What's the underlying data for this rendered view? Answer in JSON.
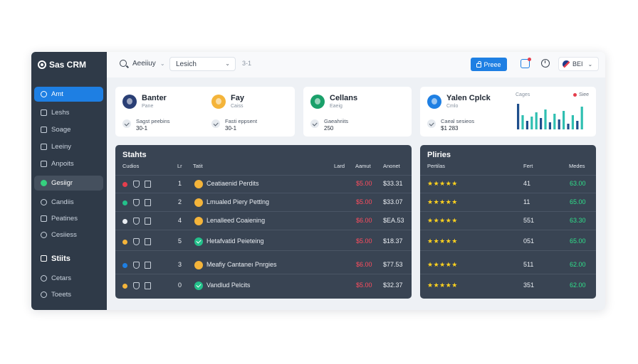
{
  "app": {
    "title": "Sas CRM"
  },
  "sidebar": {
    "items": [
      {
        "label": "Amt",
        "icon": "home-icon",
        "state": "active"
      },
      {
        "label": "Leshs",
        "icon": "pencil-icon",
        "state": ""
      },
      {
        "label": "Soage",
        "icon": "folder-icon",
        "state": ""
      },
      {
        "label": "Leeiny",
        "icon": "list-icon",
        "state": ""
      },
      {
        "label": "Anpoits",
        "icon": "calendar-icon",
        "state": ""
      },
      {
        "label": "Gesiigr",
        "icon": "gear-icon",
        "state": "hover"
      },
      {
        "label": "Candiis",
        "icon": "chat-icon",
        "state": ""
      },
      {
        "label": "Peatines",
        "icon": "box-icon",
        "state": ""
      },
      {
        "label": "Cesiiess",
        "icon": "users-icon",
        "state": ""
      },
      {
        "label": "Stiits",
        "icon": "chart-icon",
        "state": "heading"
      },
      {
        "label": "Cetars",
        "icon": "settings-icon",
        "state": ""
      },
      {
        "label": "Toeets",
        "icon": "ticket-icon",
        "state": ""
      }
    ]
  },
  "topbar": {
    "filter_label": "Aeeiiuy",
    "select_value": "Lesich",
    "meta": "3-1",
    "primary_button": "Preee",
    "user": "BEI"
  },
  "cards": [
    {
      "contacts": [
        {
          "name": "Banter",
          "sub": "Pane",
          "metric_label": "Sagst peebins",
          "metric_value": "30-1",
          "avatar_color": "#2a3f75"
        },
        {
          "name": "Fay",
          "sub": "Caiss",
          "metric_label": "Fasti eppsent",
          "metric_value": "30-1",
          "avatar_color": "#f4b43a"
        }
      ]
    },
    {
      "contacts": [
        {
          "name": "Cellans",
          "sub": "Eaeig",
          "metric_label": "Gaeahriits",
          "metric_value": "250",
          "avatar_color": "#1aa06a"
        }
      ]
    },
    {
      "contacts": [
        {
          "name": "Yalen Cplck",
          "sub": "Cmlo",
          "metric_label": "Caeal sesieos",
          "metric_value": "$1 283",
          "avatar_color": "#1e7fe3"
        }
      ],
      "spark_title": "Cages",
      "spark_legend": "Siee"
    }
  ],
  "stats_panel": {
    "title": "Stahts",
    "headers": {
      "status": "Cudios",
      "num": "Lr",
      "name": "Tatit",
      "lead": "Lard",
      "amount": "Aamut",
      "total": "Anonet"
    },
    "rows": [
      {
        "dot_color": "#e53e4d",
        "num": "1",
        "product": "Ceatiaenid Perdits",
        "icon_variant": "",
        "lead": "$5.00",
        "total": "$33.31"
      },
      {
        "dot_color": "#23c08a",
        "num": "2",
        "product": "Lmualed Piery Pettlng",
        "icon_variant": "",
        "lead": "$5.00",
        "total": "$33.07"
      },
      {
        "dot_color": "#e9edf2",
        "num": "4",
        "product": "Lenalleed Coaiening",
        "icon_variant": "",
        "lead": "$6.00",
        "total": "$EA.53"
      },
      {
        "dot_color": "#f4b43a",
        "num": "5",
        "product": "Hetafvatid Peieteing",
        "icon_variant": "teal",
        "lead": "$5.00",
        "total": "$18.37"
      },
      {
        "dot_color": "#1e7fe3",
        "num": "3",
        "product": "Meafiy Cantaneı Pnrgies",
        "icon_variant": "",
        "lead": "$6.00",
        "total": "$77.53"
      },
      {
        "dot_color": "#f4b43a",
        "num": "0",
        "product": "Vandlud Pelcits",
        "icon_variant": "teal",
        "lead": "$5.00",
        "total": "$32.37"
      }
    ]
  },
  "profiles_panel": {
    "title": "Pliries",
    "headers": {
      "name": "Pertilas",
      "num": "Fert",
      "metric": "Medes"
    },
    "rows": [
      {
        "rating": 5,
        "num": "41",
        "value": "63.00"
      },
      {
        "rating": 5,
        "num": "11",
        "value": "65.00"
      },
      {
        "rating": 5,
        "num": "551",
        "value": "63.30"
      },
      {
        "rating": 5,
        "num": "051",
        "value": "65.00"
      },
      {
        "rating": 5,
        "num": "511",
        "value": "62.00"
      },
      {
        "rating": 5,
        "num": "351",
        "value": "62.00"
      }
    ]
  },
  "colors": {
    "accent": "#1e7fe3",
    "sidebar": "#2f3a48",
    "panel": "#394453",
    "danger": "#ff4d5e",
    "success": "#2fe08a",
    "star": "#ffd21e"
  },
  "spark_bars": [
    {
      "value": 36,
      "color": "#1e4f8c"
    },
    {
      "value": 20,
      "color": "#2fbfb1"
    },
    {
      "value": 12,
      "color": "#1e4f8c"
    },
    {
      "value": 18,
      "color": "#2fbfb1"
    },
    {
      "value": 24,
      "color": "#2fbfb1"
    },
    {
      "value": 16,
      "color": "#1e4f8c"
    },
    {
      "value": 28,
      "color": "#2fbfb1"
    },
    {
      "value": 10,
      "color": "#1e4f8c"
    },
    {
      "value": 22,
      "color": "#2fbfb1"
    },
    {
      "value": 14,
      "color": "#1e4f8c"
    },
    {
      "value": 26,
      "color": "#2fbfb1"
    },
    {
      "value": 8,
      "color": "#1e4f8c"
    },
    {
      "value": 20,
      "color": "#2fbfb1"
    },
    {
      "value": 12,
      "color": "#1e4f8c"
    },
    {
      "value": 32,
      "color": "#2fbfb1"
    }
  ]
}
